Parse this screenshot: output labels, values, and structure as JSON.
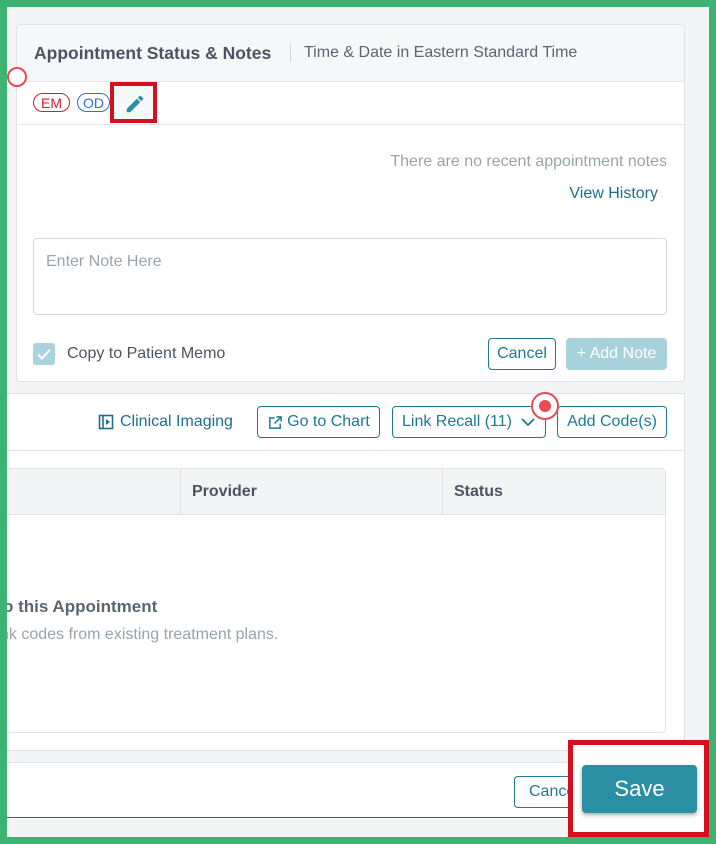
{
  "notes": {
    "title": "Appointment Status & Notes",
    "subtitle": "Time & Date in Eastern Standard Time",
    "tags": [
      {
        "label": "EM",
        "color": "#d0202e"
      },
      {
        "label": "OD",
        "color": "#2d6fd6"
      }
    ],
    "edit_icon": "pencil-icon",
    "empty_message": "There are no recent appointment notes",
    "view_history": "View History",
    "note_placeholder": "Enter Note Here",
    "note_value": "",
    "copy_to_memo_label": "Copy to Patient Memo",
    "copy_to_memo_checked": true,
    "cancel_label": "Cancel",
    "add_note_label": "+ Add Note"
  },
  "codes": {
    "clinical_imaging": "Clinical Imaging",
    "go_to_chart": "Go to Chart",
    "link_recall": "Link Recall (11)",
    "add_codes": "Add Code(s)",
    "columns": [
      "Provider",
      "Status"
    ],
    "empty_title": "o this Appointment",
    "empty_sub": "nk codes from existing treatment plans."
  },
  "footer": {
    "cancel_label": "Cance",
    "save_label": "Save"
  },
  "colors": {
    "accent": "#1f7a90",
    "save": "#2a8fa3",
    "highlight": "#d60f1f",
    "frame": "#3cb371"
  }
}
